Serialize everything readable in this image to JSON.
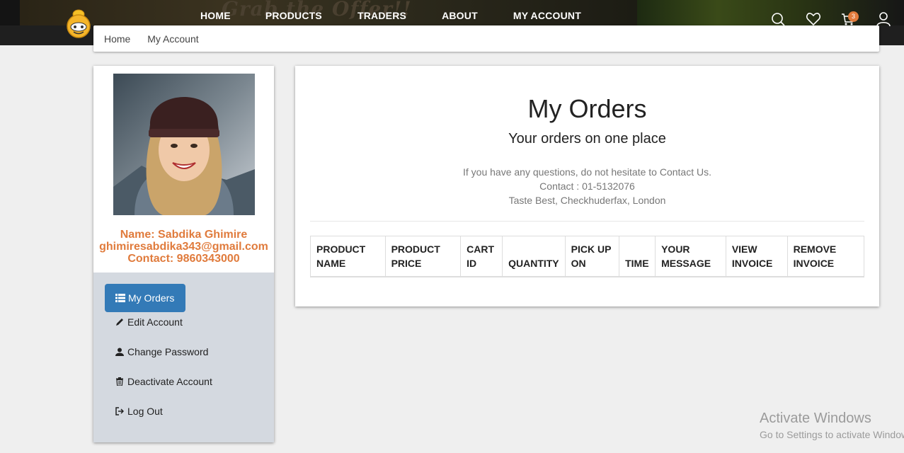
{
  "header": {
    "banner_text": "Grab the Offer!!",
    "nav": [
      {
        "label": "HOME"
      },
      {
        "label": "PRODUCTS"
      },
      {
        "label": "TRADERS"
      },
      {
        "label": "ABOUT"
      },
      {
        "label": "MY ACCOUNT"
      }
    ],
    "cart_count": "3",
    "icons": [
      "search-icon",
      "heart-icon",
      "cart-icon",
      "user-icon"
    ]
  },
  "breadcrumb": [
    "Home",
    "My Account"
  ],
  "profile": {
    "name": "Name: Sabdika Ghimire",
    "email": "ghimiresabdika343@gmail.com",
    "contact": "Contact: 9860343000"
  },
  "menu": {
    "items": [
      {
        "label": "My Orders",
        "icon": "list-icon",
        "active": true
      },
      {
        "label": "Edit Account",
        "icon": "pencil-icon"
      },
      {
        "label": "Change Password",
        "icon": "user-icon"
      },
      {
        "label": "Deactivate Account",
        "icon": "trash-icon"
      },
      {
        "label": "Log Out",
        "icon": "logout-icon"
      }
    ]
  },
  "main": {
    "title": "My Orders",
    "subtitle": "Your orders on one place",
    "contact_lines": [
      "If you have any questions, do not hesitate to Contact Us.",
      "Contact : 01-5132076",
      "Taste Best, Checkhuderfax, London"
    ],
    "table_headers": [
      {
        "line1": "PRODUCT",
        "line2": "NAME"
      },
      {
        "line1": "PRODUCT",
        "line2": "PRICE"
      },
      {
        "line1": "CART",
        "line2": "ID"
      },
      {
        "line1": "",
        "line2": "QUANTITY"
      },
      {
        "line1": "PICK UP",
        "line2": "ON"
      },
      {
        "line1": "",
        "line2": "TIME"
      },
      {
        "line1": "YOUR",
        "line2": "MESSAGE"
      },
      {
        "line1": "VIEW",
        "line2": "INVOICE"
      },
      {
        "line1": "REMOVE",
        "line2": "INVOICE"
      }
    ]
  },
  "watermark": {
    "line1": "Activate Windows",
    "line2": "Go to Settings to activate Windows."
  },
  "colors": {
    "accent": "#e07b3c",
    "active_menu": "#337ab7",
    "menu_bg": "#d4d9e0"
  }
}
